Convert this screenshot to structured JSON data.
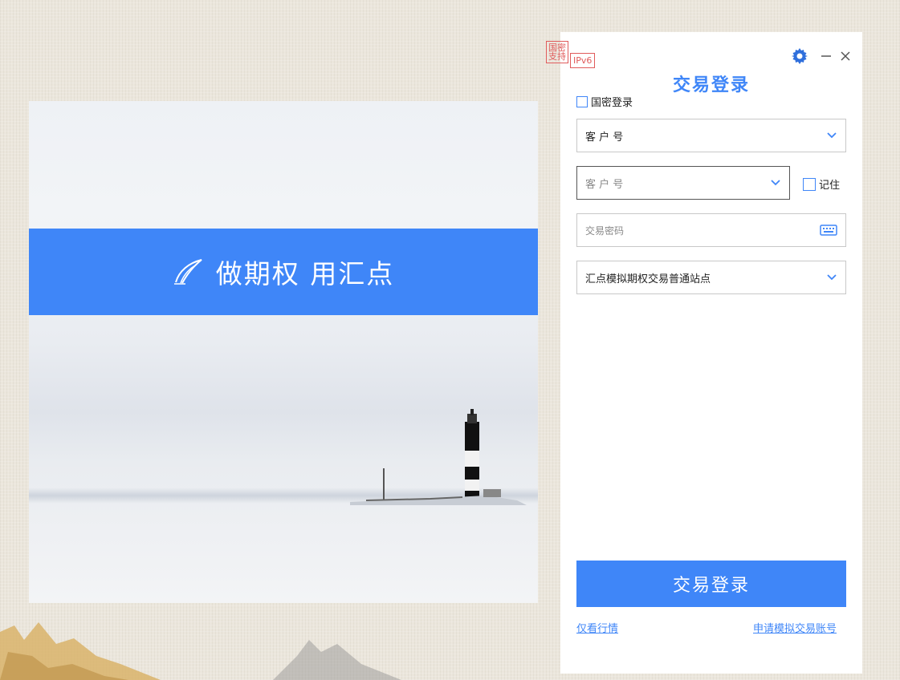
{
  "banner": {
    "slogan": "做期权 用汇点",
    "logo_icon": "quill-logo-icon"
  },
  "panel": {
    "badges": {
      "guomi_support": "国密支持",
      "ipv6": "IPv6"
    },
    "title": "交易登录",
    "guomi_login_label": "国密登录",
    "account_type": {
      "value": "客 户 号"
    },
    "account_input": {
      "placeholder": "客 户 号"
    },
    "remember_label": "记住",
    "password_input": {
      "placeholder": "交易密码"
    },
    "site_select": {
      "value": "汇点模拟期权交易普通站点"
    },
    "login_button": "交易登录",
    "link_quotes_only": "仅看行情",
    "link_apply_sim_account": "申请模拟交易账号"
  },
  "colors": {
    "accent": "#3f86f8",
    "badge_red": "#e05b5b"
  }
}
